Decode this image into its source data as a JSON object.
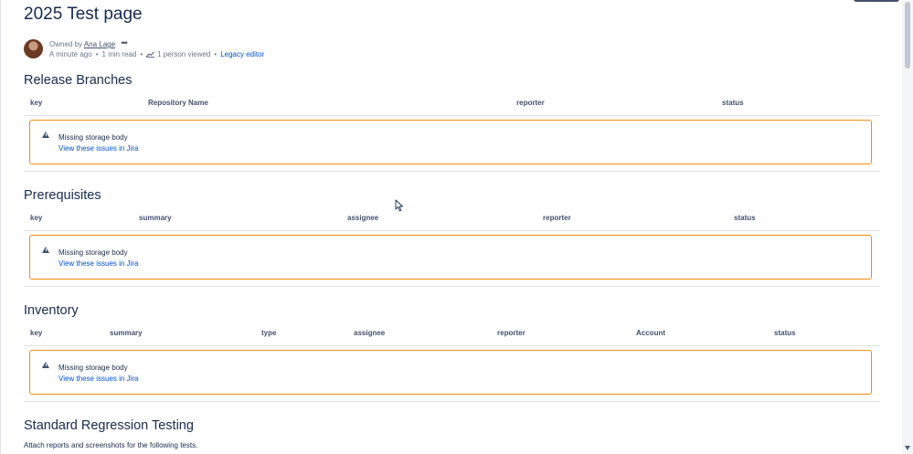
{
  "page": {
    "title": "2025 Test page"
  },
  "byline": {
    "owned_by": "Owned by",
    "owner": "Ana Lage",
    "more_glyph": "•••",
    "time": "A minute ago",
    "read_time": "1 min read",
    "views": "1 person viewed",
    "editor_link": "Legacy editor"
  },
  "sections": {
    "release": {
      "heading": "Release Branches",
      "columns": [
        "key",
        "Repository Name",
        "reporter",
        "status"
      ],
      "warning": "Missing storage body",
      "link": "View these issues in Jira"
    },
    "prereq": {
      "heading": "Prerequisites",
      "columns": [
        "key",
        "summary",
        "assignee",
        "reporter",
        "status"
      ],
      "warning": "Missing storage body",
      "link": "View these issues in Jira"
    },
    "inventory": {
      "heading": "Inventory",
      "columns": [
        "key",
        "summary",
        "type",
        "assignee",
        "reporter",
        "Account",
        "status"
      ],
      "warning": "Missing storage body",
      "link": "View these issues in Jira"
    },
    "regression": {
      "heading": "Standard Regression Testing",
      "text": "Attach reports and screenshots for the following tests."
    }
  },
  "colors": {
    "warning_border": "#f18d13",
    "link": "#0052cc",
    "text": "#172b4d"
  },
  "icons": {
    "more": "more-icon",
    "views": "chart-icon",
    "warning": "warning-icon",
    "cursor": "mouse-pointer-icon"
  }
}
